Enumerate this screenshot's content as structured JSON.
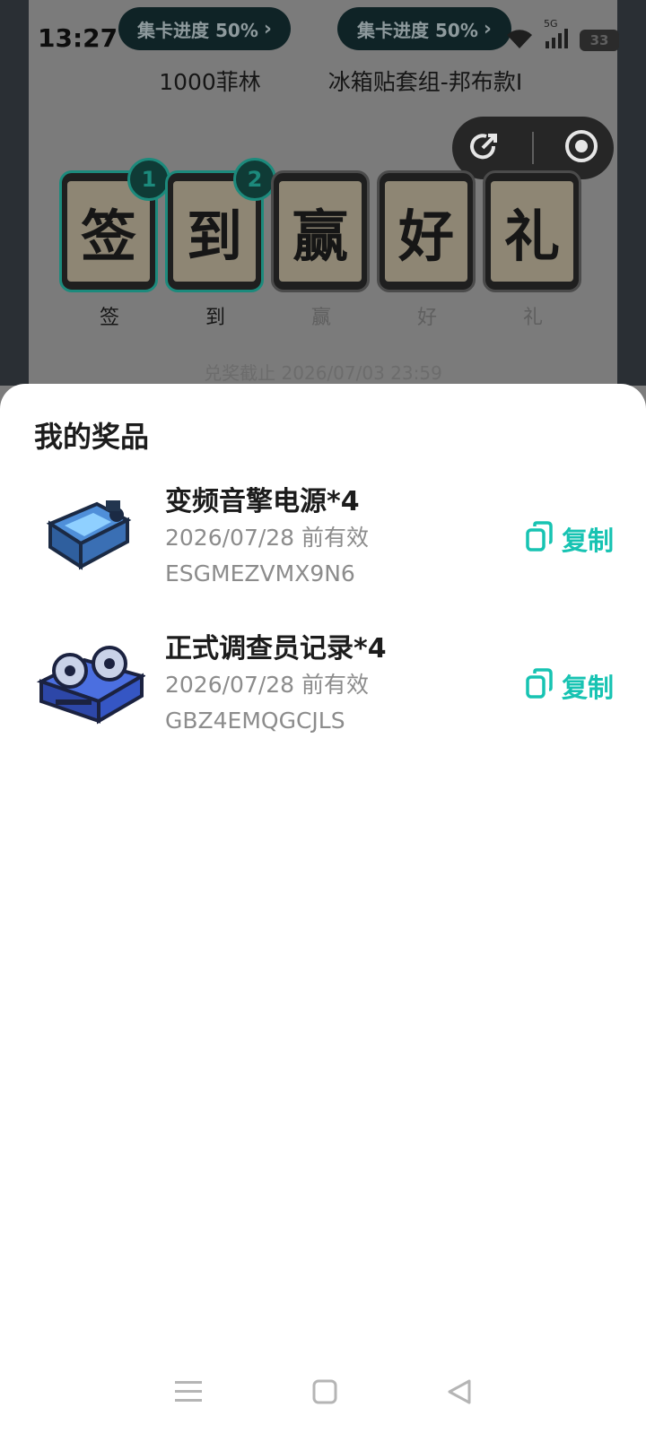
{
  "status_bar": {
    "time": "13:27",
    "battery": "33",
    "network": "5G"
  },
  "background": {
    "progress_pills": [
      {
        "label": "集卡进度 50%"
      },
      {
        "label": "集卡进度 50%"
      }
    ],
    "prize_names": [
      "1000菲林",
      "冰箱贴套组-邦布款I"
    ],
    "tiles": [
      {
        "char": "签",
        "label": "签",
        "badge": "1",
        "collected": true
      },
      {
        "char": "到",
        "label": "到",
        "badge": "2",
        "collected": true
      },
      {
        "char": "赢",
        "label": "赢",
        "badge": "",
        "collected": false
      },
      {
        "char": "好",
        "label": "好",
        "badge": "",
        "collected": false
      },
      {
        "char": "礼",
        "label": "礼",
        "badge": "",
        "collected": false
      }
    ],
    "deadline": "兑奖截止 2026/07/03 23:59"
  },
  "sheet": {
    "title": "我的奖品",
    "prizes": [
      {
        "name": "变频音擎电源*4",
        "valid": "2026/07/28 前有效",
        "code": "ESGMEZVMX9N6",
        "copy_label": "复制",
        "icon": "power-device-icon"
      },
      {
        "name": "正式调查员记录*4",
        "valid": "2026/07/28 前有效",
        "code": "GBZ4EMQGCJLS",
        "copy_label": "复制",
        "icon": "tape-recorder-icon"
      }
    ]
  },
  "colors": {
    "accent": "#17c3b2",
    "progress_border": "#1c8a7c"
  }
}
